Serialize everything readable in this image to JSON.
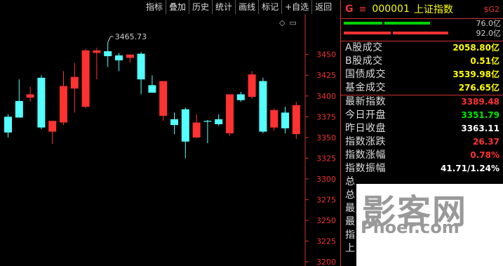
{
  "toolbar": [
    "指标",
    "叠加",
    "历史",
    "统计",
    "画线",
    "标记",
    "+自选",
    "返回"
  ],
  "icons": [
    "diamond-icon",
    "window-icon"
  ],
  "chart_data": {
    "type": "candlestick",
    "y_ticks": [
      3450,
      3425,
      3400,
      3375,
      3350,
      3325,
      3300,
      3275,
      3250,
      3225,
      3200
    ],
    "ylim": [
      3200,
      3465
    ],
    "max_label": "3465.73",
    "candles": [
      {
        "o": 3375,
        "h": 3378,
        "l": 3350,
        "c": 3356
      },
      {
        "o": 3394,
        "h": 3420,
        "l": 3375,
        "c": 3374
      },
      {
        "o": 3398,
        "h": 3411,
        "l": 3393,
        "c": 3402
      },
      {
        "o": 3422,
        "h": 3425,
        "l": 3360,
        "c": 3362
      },
      {
        "o": 3357,
        "h": 3367,
        "l": 3342,
        "c": 3370
      },
      {
        "o": 3368,
        "h": 3430,
        "l": 3365,
        "c": 3412
      },
      {
        "o": 3409,
        "h": 3440,
        "l": 3380,
        "c": 3423
      },
      {
        "o": 3387,
        "h": 3457,
        "l": 3385,
        "c": 3455
      },
      {
        "o": 3452,
        "h": 3458,
        "l": 3420,
        "c": 3455
      },
      {
        "o": 3454,
        "h": 3465,
        "l": 3435,
        "c": 3448
      },
      {
        "o": 3449,
        "h": 3452,
        "l": 3430,
        "c": 3443
      },
      {
        "o": 3446,
        "h": 3450,
        "l": 3440,
        "c": 3450
      },
      {
        "o": 3451,
        "h": 3453,
        "l": 3402,
        "c": 3420
      },
      {
        "o": 3413,
        "h": 3425,
        "l": 3405,
        "c": 3404
      },
      {
        "o": 3376,
        "h": 3405,
        "l": 3370,
        "c": 3418
      },
      {
        "o": 3372,
        "h": 3380,
        "l": 3354,
        "c": 3365
      },
      {
        "o": 3384,
        "h": 3386,
        "l": 3325,
        "c": 3345
      },
      {
        "o": 3350,
        "h": 3378,
        "l": 3349,
        "c": 3368
      },
      {
        "o": 3370,
        "h": 3371,
        "l": 3343,
        "c": 3369
      },
      {
        "o": 3372,
        "h": 3378,
        "l": 3364,
        "c": 3366
      },
      {
        "o": 3355,
        "h": 3402,
        "l": 3352,
        "c": 3402
      },
      {
        "o": 3402,
        "h": 3405,
        "l": 3393,
        "c": 3395
      },
      {
        "o": 3399,
        "h": 3430,
        "l": 3397,
        "c": 3426
      },
      {
        "o": 3418,
        "h": 3422,
        "l": 3355,
        "c": 3357
      },
      {
        "o": 3362,
        "h": 3385,
        "l": 3358,
        "c": 3383
      },
      {
        "o": 3380,
        "h": 3387,
        "l": 3355,
        "c": 3361
      },
      {
        "o": 3354,
        "h": 3393,
        "l": 3348,
        "c": 3389
      }
    ]
  },
  "panel": {
    "g": "G",
    "menu": "≡",
    "code": "000001",
    "name": "上证指数",
    "badge": "$G2",
    "bars": [
      {
        "label": "76.0亿",
        "segments": [
          {
            "color": "#00d000",
            "frac": 0.46
          },
          {
            "color": "#00d000",
            "frac": 0.54
          }
        ],
        "fill": 0.62
      },
      {
        "label": "92.0亿",
        "segments": [
          {
            "color": "#ff3232",
            "frac": 0.46
          },
          {
            "color": "#ff3232",
            "frac": 0.54
          }
        ],
        "fill": 0.75
      }
    ],
    "volumes": [
      {
        "k": "A股成交",
        "v": "2058.80亿",
        "cls": "c-yellow"
      },
      {
        "k": "B股成交",
        "v": "0.51亿",
        "cls": "c-yellow"
      },
      {
        "k": "国债成交",
        "v": "3539.98亿",
        "cls": "c-yellow"
      },
      {
        "k": "基金成交",
        "v": "276.65亿",
        "cls": "c-yellow"
      }
    ],
    "stats": [
      {
        "k": "最新指数",
        "v": "3389.48",
        "cls": "c-red"
      },
      {
        "k": "今日开盘",
        "v": "3351.79",
        "cls": "c-green"
      },
      {
        "k": "昨日收盘",
        "v": "3363.11",
        "cls": "c-white"
      },
      {
        "k": "指数涨跌",
        "v": "26.37",
        "cls": "c-red"
      },
      {
        "k": "指数涨幅",
        "v": "0.78%",
        "cls": "c-red"
      },
      {
        "k": "指数振幅",
        "v": "41.71/1.24%",
        "cls": "c-white"
      }
    ],
    "partial": [
      "总",
      "总",
      "最",
      "最",
      "指",
      "上"
    ]
  },
  "watermark": {
    "main": "影客网",
    "sub": "Phoer.com"
  }
}
